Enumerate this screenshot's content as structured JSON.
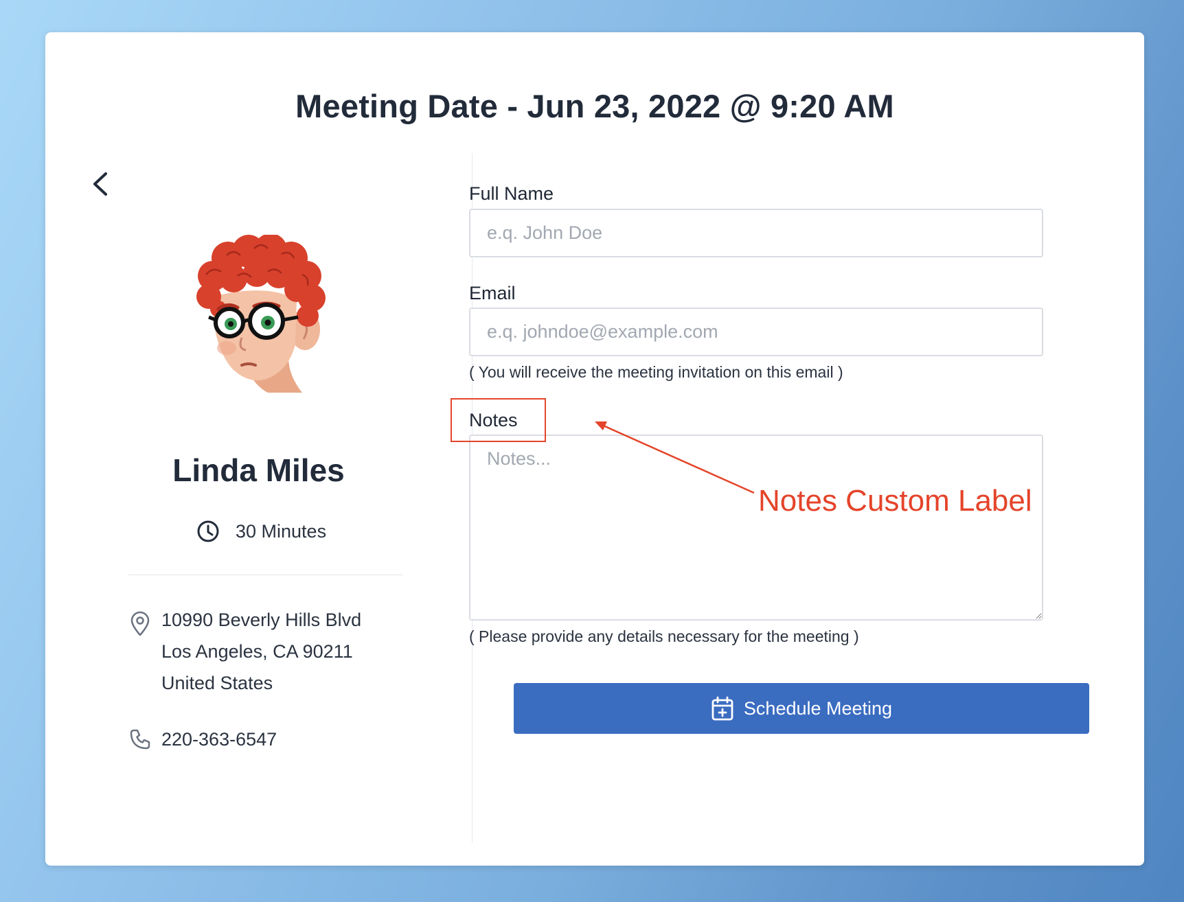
{
  "header": {
    "title": "Meeting Date - Jun 23, 2022 @ 9:20 AM"
  },
  "host": {
    "name": "Linda Miles",
    "duration": "30 Minutes",
    "address_line1": "10990 Beverly Hills Blvd",
    "address_line2": "Los Angeles, CA 90211",
    "address_line3": "United States",
    "phone": "220-363-6547"
  },
  "form": {
    "full_name_label": "Full Name",
    "full_name_placeholder": "e.q. John Doe",
    "full_name_value": "",
    "email_label": "Email",
    "email_placeholder": "e.q. johndoe@example.com",
    "email_value": "",
    "email_help": "( You will receive the meeting invitation on this email )",
    "notes_label": "Notes",
    "notes_placeholder": "Notes...",
    "notes_value": "",
    "notes_help": "( Please provide any details necessary for the meeting )",
    "submit_label": "Schedule Meeting"
  },
  "annotation": {
    "text": "Notes Custom Label",
    "color": "#e4442a"
  },
  "icons": {
    "back": "chevron-left-icon",
    "duration": "clock-icon",
    "address": "map-pin-icon",
    "phone": "phone-icon",
    "submit": "calendar-plus-icon"
  },
  "colors": {
    "primary_button": "#3a6cc0",
    "text": "#222b3a",
    "annotation": "#e4442a"
  }
}
